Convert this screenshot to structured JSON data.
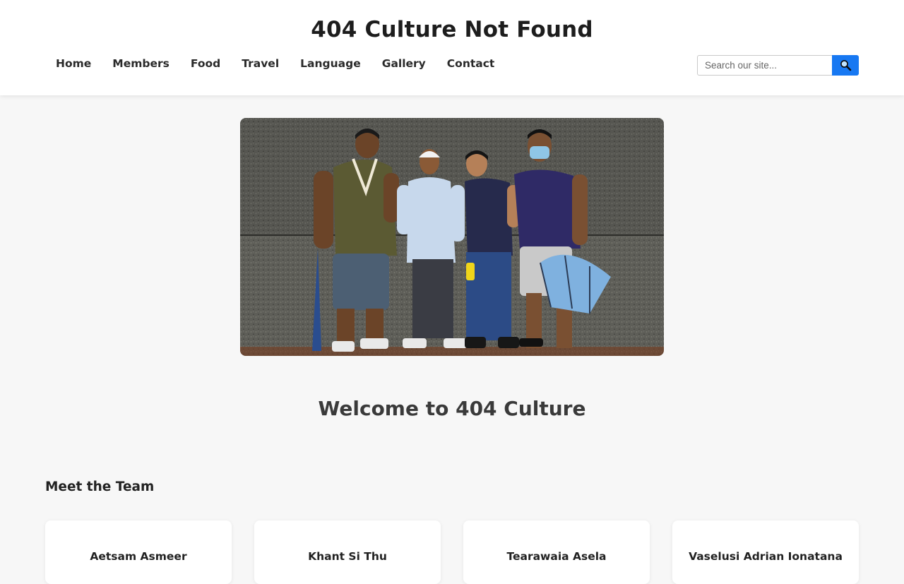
{
  "site": {
    "title": "404 Culture Not Found"
  },
  "nav": {
    "items": [
      {
        "label": "Home"
      },
      {
        "label": "Members"
      },
      {
        "label": "Food"
      },
      {
        "label": "Travel"
      },
      {
        "label": "Language"
      },
      {
        "label": "Gallery"
      },
      {
        "label": "Contact"
      }
    ]
  },
  "search": {
    "placeholder": "Search our site...",
    "button_icon": "magnifier-icon"
  },
  "hero": {
    "image": "group-photo"
  },
  "main": {
    "welcome": "Welcome to 404 Culture"
  },
  "team": {
    "heading": "Meet the Team",
    "members": [
      {
        "name": "Aetsam Asmeer"
      },
      {
        "name": "Khant Si Thu"
      },
      {
        "name": "Tearawaia Asela"
      },
      {
        "name": "Vaselusi Adrian Ionatana"
      }
    ]
  },
  "colors": {
    "accent": "#1778f2",
    "background": "#f7f7f7",
    "header": "#ffffff"
  }
}
